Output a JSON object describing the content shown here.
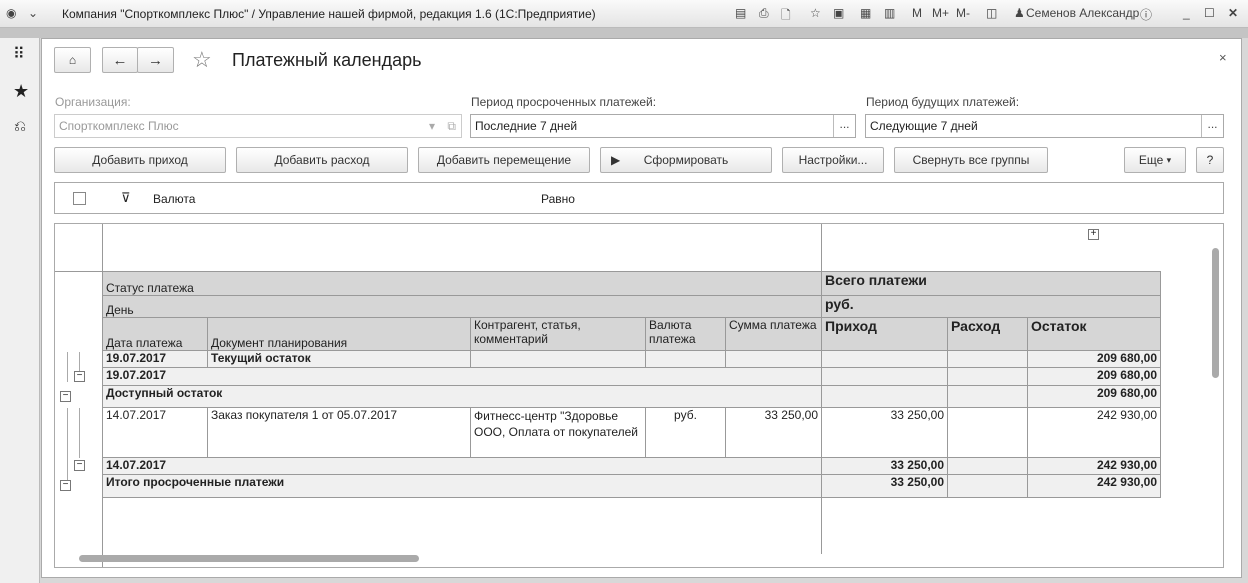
{
  "window": {
    "title": "Компания \"Спорткомплекс Плюс\" / Управление нашей фирмой, редакция 1.6  (1С:Предприятие)",
    "user": "Семенов Александр",
    "m": "M",
    "mplus": "M+",
    "mminus": "M-"
  },
  "form": {
    "title": "Платежный календарь"
  },
  "filters": {
    "org_label": "Организация:",
    "org_value": "Спорткомплекс Плюс",
    "overdue_label": "Период просроченных платежей:",
    "overdue_value": "Последние 7 дней",
    "future_label": "Период будущих платежей:",
    "future_value": "Следующие 7 дней"
  },
  "toolbar": {
    "add_income": "Добавить приход",
    "add_expense": "Добавить расход",
    "add_transfer": "Добавить перемещение",
    "generate": "Сформировать",
    "settings": "Настройки...",
    "collapse": "Свернуть все группы",
    "more": "Еще",
    "help": "?"
  },
  "filter_row": {
    "field": "Валюта",
    "condition": "Равно"
  },
  "report": {
    "h_status": "Статус платежа",
    "h_day": "День",
    "h_date": "Дата платежа",
    "h_doc": "Документ планирования",
    "h_contr": "Контрагент, статья, комментарий",
    "h_curr": "Валюта платежа",
    "h_sum": "Сумма платежа",
    "h_total": "Всего платежи",
    "h_rub": "руб.",
    "h_in": "Приход",
    "h_out": "Расход",
    "h_bal": "Остаток",
    "rows": [
      {
        "date": "19.07.2017",
        "doc": "Текущий остаток",
        "bal": "209 680,00"
      },
      {
        "date": "19.07.2017",
        "bal": "209 680,00"
      },
      {
        "label": "Доступный остаток",
        "bal": "209 680,00"
      },
      {
        "date": "14.07.2017",
        "doc": "Заказ покупателя 1 от 05.07.2017",
        "contr": "Фитнесс-центр \"Здоровье ООО, Оплата от покупателей",
        "curr": "руб.",
        "sum": "33 250,00",
        "in": "33 250,00",
        "bal": "242 930,00"
      },
      {
        "date": "14.07.2017",
        "in": "33 250,00",
        "bal": "242 930,00"
      },
      {
        "label": "Итого просроченные платежи",
        "in": "33 250,00",
        "bal": "242 930,00"
      }
    ]
  }
}
